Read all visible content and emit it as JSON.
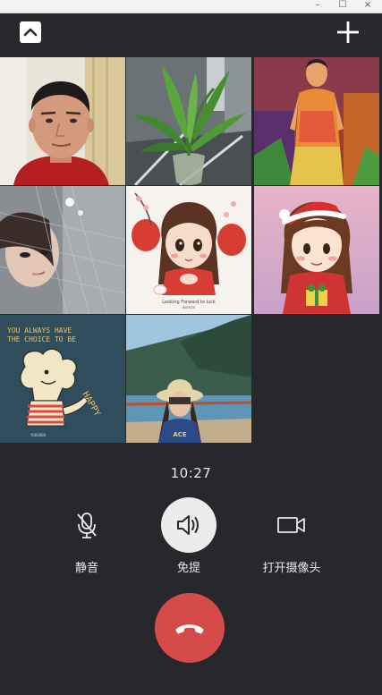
{
  "window": {
    "minimize_glyph": "–",
    "maximize_glyph": "☐",
    "close_glyph": "×"
  },
  "header": {
    "collapse_icon": "chevron-up-icon",
    "add_icon": "plus-icon"
  },
  "participants": [
    {
      "id": "p1",
      "avatar": "man-video-feed"
    },
    {
      "id": "p2",
      "avatar": "potted-plant-photo"
    },
    {
      "id": "p3",
      "avatar": "painting-figure"
    },
    {
      "id": "p4",
      "avatar": "girl-behind-screen-photo"
    },
    {
      "id": "p5",
      "avatar": "cartoon-girl-lanterns"
    },
    {
      "id": "p6",
      "avatar": "cartoon-girl-santa-hat"
    },
    {
      "id": "p7",
      "avatar": "happy-cartoon-character"
    },
    {
      "id": "p8",
      "avatar": "woman-seaside-photo"
    }
  ],
  "call": {
    "duration": "10:27",
    "mute_label": "静音",
    "speaker_label": "免提",
    "camera_label": "打开摄像头",
    "hangup_icon": "phone-hangup-icon"
  },
  "colors": {
    "background": "#27282c",
    "hangup": "#d54b49",
    "speaker_active": "#ececec"
  },
  "artwork_text": {
    "cartoon_caption": "Looking Forward to luck",
    "cartoon_caption_2": "woman",
    "happy_line_1": "YOU ALWAYS HAVE",
    "happy_line_2": "THE CHOICE TO BE",
    "happy_word": "HAPPY",
    "happy_credit": "YOUSHEN",
    "shirt_text": "ACE"
  }
}
